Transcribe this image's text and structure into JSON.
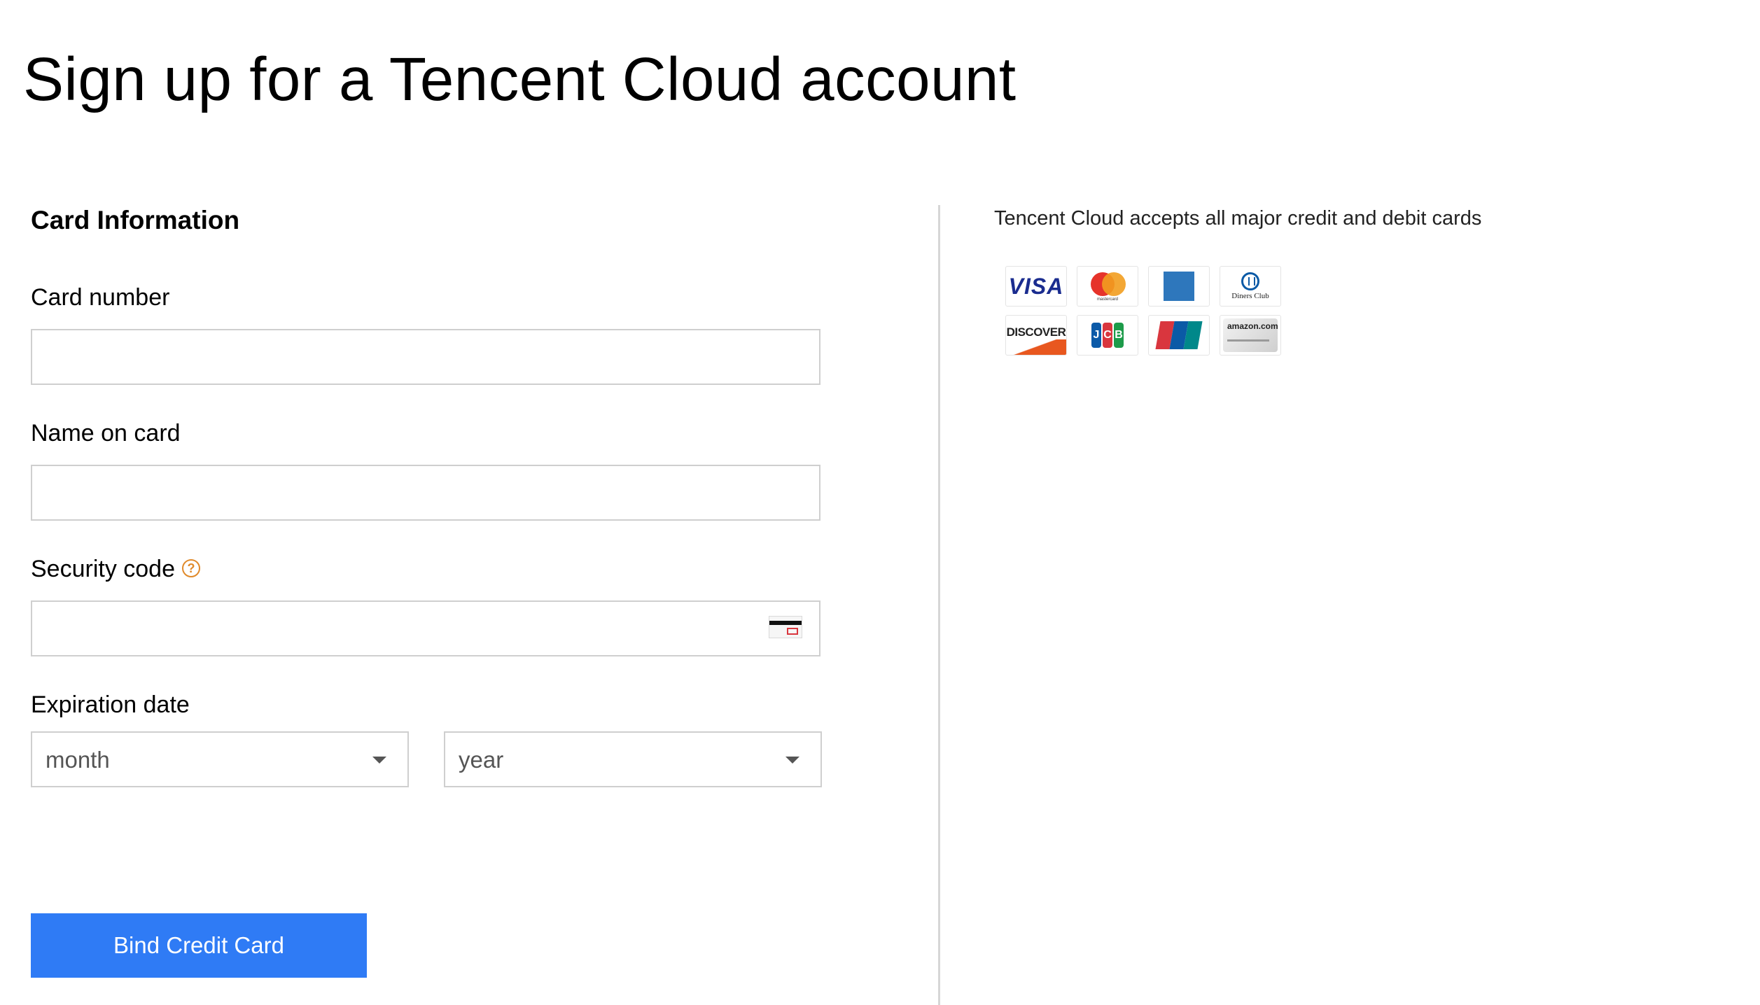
{
  "page": {
    "title": "Sign up for a Tencent Cloud account"
  },
  "form": {
    "section_title": "Card Information",
    "card_number": {
      "label": "Card number",
      "value": "",
      "placeholder": ""
    },
    "name_on_card": {
      "label": "Name on card",
      "value": "",
      "placeholder": ""
    },
    "security_code": {
      "label": "Security code",
      "help_icon": "question-circle-icon",
      "help_glyph": "?",
      "value": "",
      "placeholder": "",
      "trailing_icon": "cvv-card-icon"
    },
    "expiration": {
      "label": "Expiration date",
      "month": {
        "selected": "month"
      },
      "year": {
        "selected": "year"
      }
    },
    "submit_label": "Bind Credit Card"
  },
  "sidebar": {
    "accept_text": "Tencent Cloud accepts all major credit and debit cards",
    "cards": [
      {
        "name": "visa-logo",
        "text": "VISA"
      },
      {
        "name": "mastercard-logo",
        "text": "mastercard"
      },
      {
        "name": "amex-logo",
        "text": ""
      },
      {
        "name": "diners-club-logo",
        "text": "Diners Club"
      },
      {
        "name": "discover-logo",
        "text": "DISCOVER"
      },
      {
        "name": "jcb-logo",
        "text": "JCB"
      },
      {
        "name": "unionpay-logo",
        "text": ""
      },
      {
        "name": "amazon-card-logo",
        "text": "amazon.com"
      }
    ]
  },
  "colors": {
    "primary_button": "#2f7bf5",
    "help_icon": "#e08a2b",
    "input_border": "#cfcfcf",
    "divider": "#d6d6d6"
  }
}
